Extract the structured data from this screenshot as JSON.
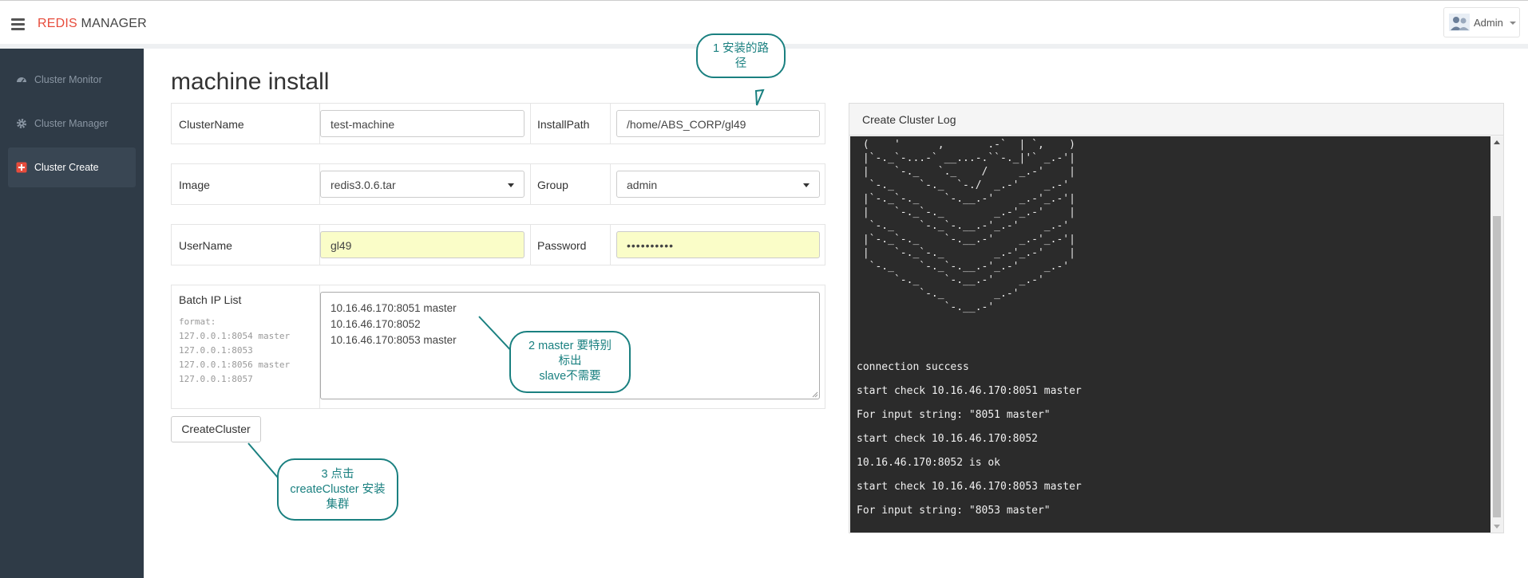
{
  "header": {
    "brand_part1": "REDIS",
    "brand_part2": " MANAGER",
    "user_name": "Admin"
  },
  "sidebar": {
    "items": [
      {
        "label": "Cluster Monitor",
        "icon": "dashboard-icon"
      },
      {
        "label": "Cluster Manager",
        "icon": "gear-icon"
      },
      {
        "label": "Cluster Create",
        "icon": "plus-square-icon",
        "active": true
      }
    ]
  },
  "page": {
    "title": "machine install"
  },
  "form": {
    "cluster_name_label": "ClusterName",
    "cluster_name_value": "test-machine",
    "install_path_label": "InstallPath",
    "install_path_value": "/home/ABS_CORP/gl49",
    "image_label": "Image",
    "image_value": "redis3.0.6.tar",
    "group_label": "Group",
    "group_value": "admin",
    "username_label": "UserName",
    "username_value": "gl49",
    "password_label": "Password",
    "password_value": "••••••••••",
    "batch_label": "Batch IP List",
    "batch_hint": [
      "format:",
      "127.0.0.1:8054 master",
      "127.0.0.1:8053",
      "127.0.0.1:8056 master",
      "127.0.0.1:8057"
    ],
    "batch_lines": [
      "10.16.46.170:8051 master",
      "10.16.46.170:8052",
      "10.16.46.170:8053 master"
    ],
    "submit_label": "CreateCluster"
  },
  "log": {
    "title": "Create Cluster Log",
    "ascii_art": " (    '      ,       .-`  | `,    )\n |`-._`-...-` __...-.``-._|'` _.-'|\n |    `-._   `._    /     _.-'    |\n  `-._    `-._  `-./  _.-'    _.-'\n |`-._`-._    `-.__.-'    _.-'_.-'|\n |    `-._`-._        _.-'_.-'    |\n  `-._    `-._`-.__.-'_.-'    _.-'\n |`-._`-._    `-.__.-'    _.-'_.-'|\n |    `-._`-._        _.-'_.-'    |\n  `-._    `-._`-.__.-'_.-'    _.-'\n      `-._    `-.__.-'    _.-'\n          `-._        _.-'\n              `-.__.-'",
    "lines": [
      "connection success",
      "start check 10.16.46.170:8051 master",
      "For input string: \"8051 master\"",
      "start check 10.16.46.170:8052",
      "10.16.46.170:8052 is ok",
      "start check 10.16.46.170:8053 master",
      "For input string: \"8053 master\""
    ]
  },
  "annotations": {
    "callout1": [
      "1 安装的路",
      "径"
    ],
    "callout2": [
      "2 master 要特别",
      "标出",
      "slave不需要"
    ],
    "callout3": [
      "3 点击",
      "createCluster 安装",
      "集群"
    ]
  },
  "colors": {
    "brand_accent": "#e74c3c",
    "sidebar_bg": "#2f3b47",
    "callout": "#1a8080",
    "autofill": "#fafdc8",
    "log_bg": "#2b2b2b",
    "active_icon": "#e74c3c"
  }
}
